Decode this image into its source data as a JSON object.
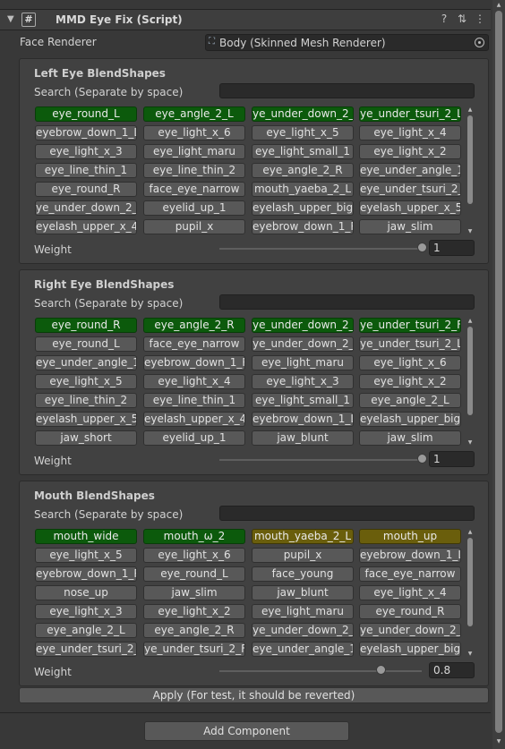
{
  "component": {
    "title": "MMD Eye Fix (Script)",
    "script_icon": "#",
    "fold_icon": "▼",
    "help_icon": "?",
    "preset_icon": "⇅",
    "menu_icon": "⋮"
  },
  "face_renderer": {
    "label": "Face Renderer",
    "value": "Body (Skinned Mesh Renderer)",
    "icon": "skinned-mesh-icon"
  },
  "panels": [
    {
      "title": "Left Eye BlendShapes",
      "search_label": "Search (Separate by space)",
      "weight_label": "Weight",
      "weight_value": "1",
      "weight_fraction": 1.0,
      "buttons": [
        {
          "label": "eye_round_L",
          "state": "on"
        },
        {
          "label": "eye_angle_2_L",
          "state": "on"
        },
        {
          "label": "ye_under_down_2_",
          "state": "on"
        },
        {
          "label": "ye_under_tsuri_2_L",
          "state": "on"
        },
        {
          "label": "eyebrow_down_1_L",
          "state": "off"
        },
        {
          "label": "eye_light_x_6",
          "state": "off"
        },
        {
          "label": "eye_light_x_5",
          "state": "off"
        },
        {
          "label": "eye_light_x_4",
          "state": "off"
        },
        {
          "label": "eye_light_x_3",
          "state": "off"
        },
        {
          "label": "eye_light_maru",
          "state": "off"
        },
        {
          "label": "eye_light_small_1",
          "state": "off"
        },
        {
          "label": "eye_light_x_2",
          "state": "off"
        },
        {
          "label": "eye_line_thin_1",
          "state": "off"
        },
        {
          "label": "eye_line_thin_2",
          "state": "off"
        },
        {
          "label": "eye_angle_2_R",
          "state": "off"
        },
        {
          "label": "eye_under_angle_1",
          "state": "off"
        },
        {
          "label": "eye_round_R",
          "state": "off"
        },
        {
          "label": "face_eye_narrow",
          "state": "off"
        },
        {
          "label": "mouth_yaeba_2_L",
          "state": "off"
        },
        {
          "label": "eye_under_tsuri_2_F",
          "state": "off"
        },
        {
          "label": "ye_under_down_2_l",
          "state": "off"
        },
        {
          "label": "eyelid_up_1",
          "state": "off"
        },
        {
          "label": "eyelash_upper_big",
          "state": "off"
        },
        {
          "label": "eyelash_upper_x_5",
          "state": "off"
        },
        {
          "label": "eyelash_upper_x_4",
          "state": "off"
        },
        {
          "label": "pupil_x",
          "state": "off"
        },
        {
          "label": "eyebrow_down_1_R",
          "state": "off"
        },
        {
          "label": "jaw_slim",
          "state": "off"
        }
      ]
    },
    {
      "title": "Right Eye BlendShapes",
      "search_label": "Search (Separate by space)",
      "weight_label": "Weight",
      "weight_value": "1",
      "weight_fraction": 1.0,
      "buttons": [
        {
          "label": "eye_round_R",
          "state": "on"
        },
        {
          "label": "eye_angle_2_R",
          "state": "on"
        },
        {
          "label": "ye_under_down_2_l",
          "state": "on"
        },
        {
          "label": "ye_under_tsuri_2_F",
          "state": "on"
        },
        {
          "label": "eye_round_L",
          "state": "off"
        },
        {
          "label": "face_eye_narrow",
          "state": "off"
        },
        {
          "label": "ye_under_down_2_",
          "state": "off"
        },
        {
          "label": "ye_under_tsuri_2_L",
          "state": "off"
        },
        {
          "label": "eye_under_angle_1",
          "state": "off"
        },
        {
          "label": "eyebrow_down_1_R",
          "state": "off"
        },
        {
          "label": "eye_light_maru",
          "state": "off"
        },
        {
          "label": "eye_light_x_6",
          "state": "off"
        },
        {
          "label": "eye_light_x_5",
          "state": "off"
        },
        {
          "label": "eye_light_x_4",
          "state": "off"
        },
        {
          "label": "eye_light_x_3",
          "state": "off"
        },
        {
          "label": "eye_light_x_2",
          "state": "off"
        },
        {
          "label": "eye_line_thin_2",
          "state": "off"
        },
        {
          "label": "eye_line_thin_1",
          "state": "off"
        },
        {
          "label": "eye_light_small_1",
          "state": "off"
        },
        {
          "label": "eye_angle_2_L",
          "state": "off"
        },
        {
          "label": "eyelash_upper_x_5",
          "state": "off"
        },
        {
          "label": "eyelash_upper_x_4",
          "state": "off"
        },
        {
          "label": "eyebrow_down_1_L",
          "state": "off"
        },
        {
          "label": "eyelash_upper_big",
          "state": "off"
        },
        {
          "label": "jaw_short",
          "state": "off"
        },
        {
          "label": "eyelid_up_1",
          "state": "off"
        },
        {
          "label": "jaw_blunt",
          "state": "off"
        },
        {
          "label": "jaw_slim",
          "state": "off"
        }
      ]
    },
    {
      "title": "Mouth BlendShapes",
      "search_label": "Search (Separate by space)",
      "weight_label": "Weight",
      "weight_value": "0.8",
      "weight_fraction": 0.8,
      "buttons": [
        {
          "label": "mouth_wide",
          "state": "on"
        },
        {
          "label": "mouth_ω_2",
          "state": "on"
        },
        {
          "label": "mouth_yaeba_2_L",
          "state": "mouth"
        },
        {
          "label": "mouth_up",
          "state": "mouth"
        },
        {
          "label": "eye_light_x_5",
          "state": "off"
        },
        {
          "label": "eye_light_x_6",
          "state": "off"
        },
        {
          "label": "pupil_x",
          "state": "off"
        },
        {
          "label": "eyebrow_down_1_L",
          "state": "off"
        },
        {
          "label": "eyebrow_down_1_R",
          "state": "off"
        },
        {
          "label": "eye_round_L",
          "state": "off"
        },
        {
          "label": "face_young",
          "state": "off"
        },
        {
          "label": "face_eye_narrow",
          "state": "off"
        },
        {
          "label": "nose_up",
          "state": "off"
        },
        {
          "label": "jaw_slim",
          "state": "off"
        },
        {
          "label": "jaw_blunt",
          "state": "off"
        },
        {
          "label": "eye_light_x_4",
          "state": "off"
        },
        {
          "label": "eye_light_x_3",
          "state": "off"
        },
        {
          "label": "eye_light_x_2",
          "state": "off"
        },
        {
          "label": "eye_light_maru",
          "state": "off"
        },
        {
          "label": "eye_round_R",
          "state": "off"
        },
        {
          "label": "eye_angle_2_L",
          "state": "off"
        },
        {
          "label": "eye_angle_2_R",
          "state": "off"
        },
        {
          "label": "ye_under_down_2_",
          "state": "off"
        },
        {
          "label": "ye_under_down_2_l",
          "state": "off"
        },
        {
          "label": "eye_under_tsuri_2_L",
          "state": "off"
        },
        {
          "label": "ye_under_tsuri_2_F",
          "state": "off"
        },
        {
          "label": "eye_under_angle_1",
          "state": "off"
        },
        {
          "label": "eyelash_upper_big",
          "state": "off"
        }
      ]
    }
  ],
  "apply_label": "Apply (For test, it should be reverted)",
  "add_component_label": "Add Component"
}
